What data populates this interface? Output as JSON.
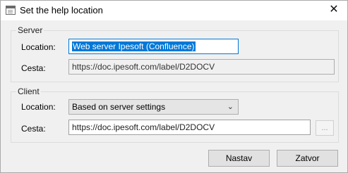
{
  "window": {
    "title": "Set the help location",
    "close_glyph": "✕"
  },
  "server": {
    "group_label": "Server",
    "location_label": "Location:",
    "location_value": "Web server Ipesoft (Confluence)",
    "cesta_label": "Cesta:",
    "cesta_value": "https://doc.ipesoft.com/label/D2DOCV"
  },
  "client": {
    "group_label": "Client",
    "location_label": "Location:",
    "location_selected": "Based on server settings",
    "cesta_label": "Cesta:",
    "cesta_value": "https://doc.ipesoft.com/label/D2DOCV",
    "browse_label": "..."
  },
  "buttons": {
    "nastav": "Nastav",
    "zatvor": "Zatvor"
  },
  "icons": {
    "window": "window-icon",
    "close": "close-icon",
    "dropdown": "chevron-down-icon"
  }
}
